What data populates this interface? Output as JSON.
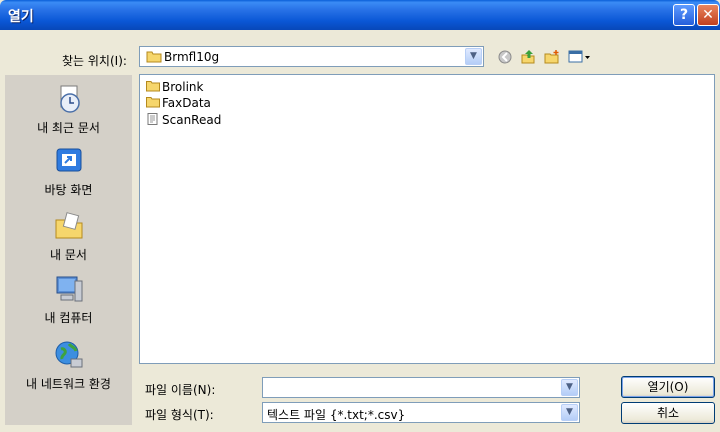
{
  "window": {
    "title": "열기"
  },
  "title_buttons": {
    "help": "?",
    "close": "✕"
  },
  "lookin": {
    "label": "찾는 위치(I):",
    "value": "Brmfl10g"
  },
  "toolbar": {
    "back_icon": "back-icon",
    "up_icon": "up-folder-icon",
    "new_folder_icon": "new-folder-icon",
    "views_icon": "views-menu-icon"
  },
  "places": [
    {
      "label": "내 최근 문서",
      "icon": "recent-documents-icon"
    },
    {
      "label": "바탕 화면",
      "icon": "desktop-icon"
    },
    {
      "label": "내 문서",
      "icon": "my-documents-icon"
    },
    {
      "label": "내 컴퓨터",
      "icon": "my-computer-icon"
    },
    {
      "label": "내 네트워크 환경",
      "icon": "network-icon"
    }
  ],
  "files": [
    {
      "name": "Brolink",
      "type": "folder"
    },
    {
      "name": "FaxData",
      "type": "folder"
    },
    {
      "name": "ScanRead",
      "type": "file"
    }
  ],
  "filename": {
    "label": "파일 이름(N):",
    "value": ""
  },
  "filetype": {
    "label": "파일 형식(T):",
    "value": "텍스트 파일 {*.txt;*.csv}"
  },
  "buttons": {
    "open": "열기(O)",
    "cancel": "취소"
  },
  "colors": {
    "titlebar": "#0a57d6",
    "window_bg": "#ece9d8",
    "places_bg": "#d4d0c8"
  }
}
